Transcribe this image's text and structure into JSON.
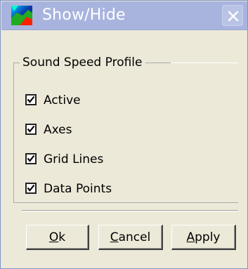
{
  "window": {
    "title": "Show/Hide",
    "close_icon": "close-icon",
    "app_icon": "colorful-map-icon"
  },
  "group": {
    "label": "Sound Speed Profile",
    "options": [
      {
        "label": "Active",
        "checked": true
      },
      {
        "label": "Axes",
        "checked": true
      },
      {
        "label": "Grid Lines",
        "checked": true
      },
      {
        "label": "Data Points",
        "checked": true
      }
    ]
  },
  "buttons": {
    "ok": {
      "mnemonic": "O",
      "rest": "k"
    },
    "cancel": {
      "mnemonic": "C",
      "rest": "ancel"
    },
    "apply": {
      "mnemonic": "A",
      "rest": "pply"
    }
  },
  "colors": {
    "titlebar": "#a8b4de",
    "dialog_bg": "#ece9d8"
  }
}
